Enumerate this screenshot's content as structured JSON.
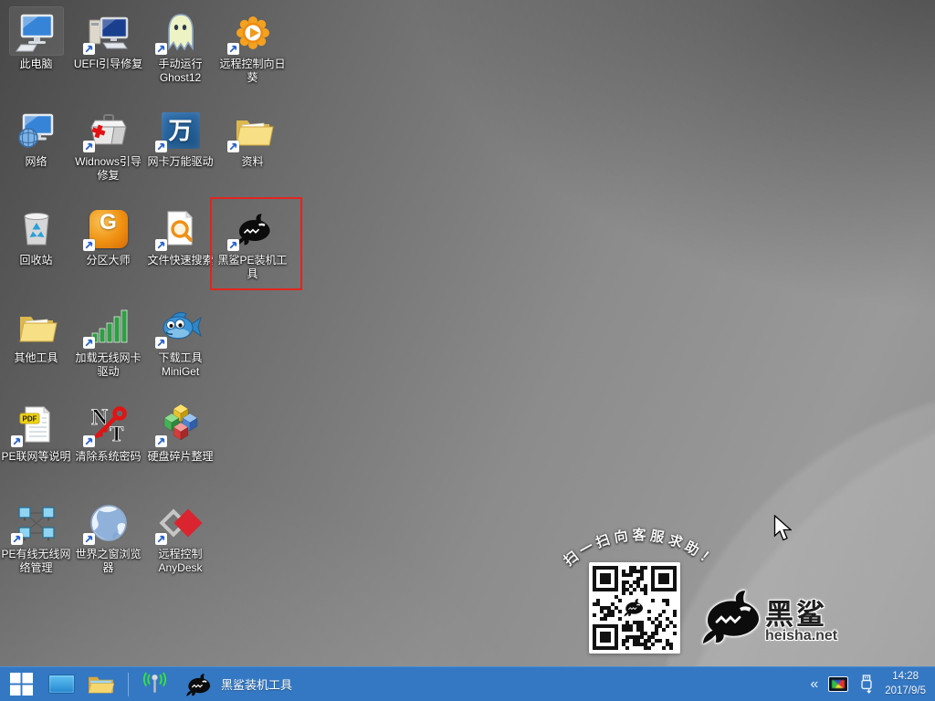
{
  "desktop": {
    "icons": [
      {
        "id": "this-pc",
        "label": "此电脑",
        "glyph": "pc",
        "shortcut": false,
        "col": 1,
        "row": 1,
        "selected": true
      },
      {
        "id": "uefi-boot-repair",
        "label": "UEFI引导修复",
        "glyph": "desktop-pc",
        "shortcut": true,
        "col": 2,
        "row": 1
      },
      {
        "id": "run-ghost12",
        "label": "手动运行Ghost12",
        "glyph": "ghost",
        "shortcut": true,
        "col": 3,
        "row": 1
      },
      {
        "id": "remote-sunflower",
        "label": "远程控制向日葵",
        "glyph": "sunflower",
        "shortcut": true,
        "col": 4,
        "row": 1
      },
      {
        "id": "network",
        "label": "网络",
        "glyph": "network",
        "shortcut": false,
        "col": 1,
        "row": 2
      },
      {
        "id": "windows-boot-repair",
        "label": "Widnows引导修复",
        "glyph": "toolbox",
        "shortcut": true,
        "col": 2,
        "row": 2
      },
      {
        "id": "nic-universal-driver",
        "label": "网卡万能驱动",
        "glyph": "wan-driver",
        "shortcut": true,
        "col": 3,
        "row": 2
      },
      {
        "id": "materials",
        "label": "资料",
        "glyph": "folder",
        "shortcut": true,
        "col": 4,
        "row": 2
      },
      {
        "id": "recycle-bin",
        "label": "回收站",
        "glyph": "recycle-bin",
        "shortcut": false,
        "col": 1,
        "row": 3
      },
      {
        "id": "partition-master",
        "label": "分区大师",
        "glyph": "diskgenius",
        "shortcut": true,
        "col": 2,
        "row": 3
      },
      {
        "id": "file-quick-search",
        "label": "文件快速搜索",
        "glyph": "file-search",
        "shortcut": true,
        "col": 3,
        "row": 3
      },
      {
        "id": "heisha-pe-tool",
        "label": "黑鲨PE装机工具",
        "glyph": "shark",
        "shortcut": true,
        "col": 4,
        "row": 3
      },
      {
        "id": "other-tools",
        "label": "其他工具",
        "glyph": "folder",
        "shortcut": false,
        "col": 1,
        "row": 4
      },
      {
        "id": "load-wireless-driver",
        "label": "加载无线网卡驱动",
        "glyph": "signal-bars",
        "shortcut": true,
        "col": 2,
        "row": 4
      },
      {
        "id": "miniget",
        "label": "下载工具MiniGet",
        "glyph": "fish",
        "shortcut": true,
        "col": 3,
        "row": 4
      },
      {
        "id": "pe-network-readme",
        "label": "PE联网等说明",
        "glyph": "pdf-doc",
        "shortcut": true,
        "col": 1,
        "row": 5
      },
      {
        "id": "clear-system-password",
        "label": "清除系统密码",
        "glyph": "nt-password",
        "shortcut": true,
        "col": 2,
        "row": 5
      },
      {
        "id": "disk-defrag",
        "label": "硬盘碎片整理",
        "glyph": "defrag-cubes",
        "shortcut": true,
        "col": 3,
        "row": 5
      },
      {
        "id": "pe-network-manager",
        "label": "PE有线无线网络管理",
        "glyph": "network-manager",
        "shortcut": true,
        "col": 1,
        "row": 6
      },
      {
        "id": "world-window-browser",
        "label": "世界之窗浏览器",
        "glyph": "globe-browser",
        "shortcut": true,
        "col": 2,
        "row": 6
      },
      {
        "id": "remote-anydesk",
        "label": "远程控制AnyDesk",
        "glyph": "anydesk",
        "shortcut": true,
        "col": 3,
        "row": 6
      }
    ]
  },
  "annotations": {
    "highlight_color": "#e1251f",
    "highlight_target": "黑鲨PE装机工具"
  },
  "promo": {
    "arc_text": "扫一扫向客服求助！",
    "brand": "黑鲨",
    "site": "heisha.net"
  },
  "taskbar": {
    "app_label": "黑鲨装机工具",
    "accent_color": "#3478c4",
    "tray": {
      "chevron": "«",
      "time": "14:28",
      "date": "2017/9/5"
    }
  }
}
